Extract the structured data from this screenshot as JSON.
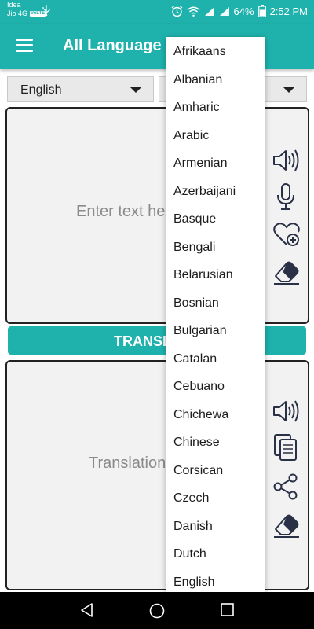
{
  "status_bar": {
    "carrier_1": "Idea",
    "carrier_2": "Jio 4G",
    "volte": "VoLTE",
    "battery": "64%",
    "time": "2:52 PM"
  },
  "app_bar": {
    "title": "All Language Translator"
  },
  "source_language": "English",
  "target_language": "",
  "input": {
    "placeholder": "Enter text here"
  },
  "translate_button": "TRANSLATE",
  "output": {
    "placeholder": "Translation"
  },
  "dropdown_languages": [
    "Afrikaans",
    "Albanian",
    "Amharic",
    "Arabic",
    "Armenian",
    "Azerbaijani",
    "Basque",
    "Bengali",
    "Belarusian",
    "Bosnian",
    "Bulgarian",
    "Catalan",
    "Cebuano",
    "Chichewa",
    "Chinese",
    "Corsican",
    "Czech",
    "Danish",
    "Dutch",
    "English"
  ],
  "icons": {
    "input": [
      "speaker-icon",
      "microphone-icon",
      "heart-plus-icon",
      "eraser-icon"
    ],
    "output": [
      "speaker-icon",
      "copy-icon",
      "share-icon",
      "eraser-icon"
    ]
  },
  "colors": {
    "accent": "#1fb2ad",
    "box_background": "#f2f2f2",
    "icon": "#2a3146"
  }
}
